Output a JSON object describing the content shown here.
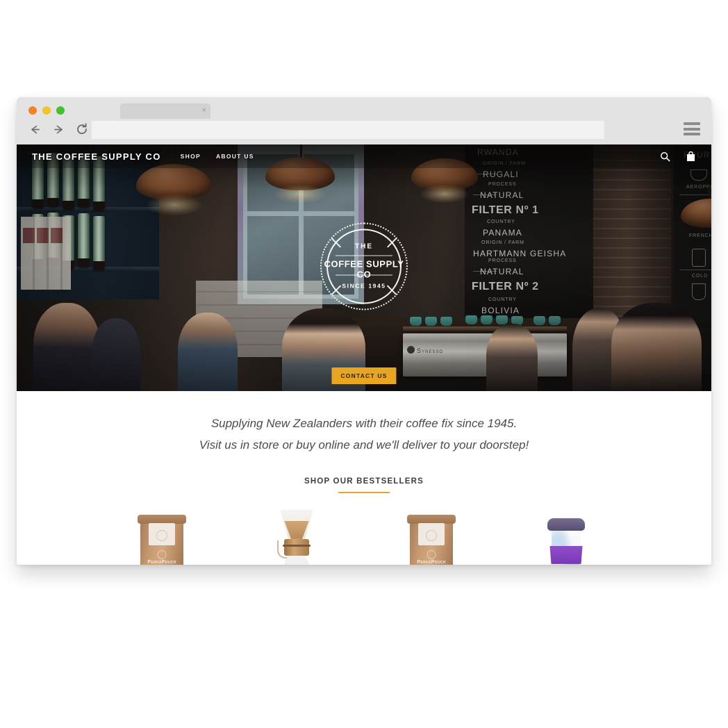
{
  "browser": {
    "tab_title": "",
    "tab_close_icon": "×",
    "address_value": "",
    "address_placeholder": "",
    "back_icon": "back-arrow-icon",
    "forward_icon": "forward-arrow-icon",
    "reload_icon": "reload-icon",
    "menu_icon": "hamburger-menu-icon",
    "traffic_lights": {
      "close": "#f7822a",
      "minimize": "#f2c42b",
      "maximize": "#44c032"
    }
  },
  "site": {
    "logo": "THE COFFEE SUPPLY CO",
    "nav": [
      {
        "label": "SHOP"
      },
      {
        "label": "ABOUT US"
      }
    ],
    "actions": [
      {
        "icon": "search-icon"
      },
      {
        "icon": "shopping-bag-icon"
      }
    ]
  },
  "hero": {
    "badge": {
      "the": "THE",
      "name": "COFFEE SUPPLY CO",
      "since": "SINCE 1945"
    },
    "cta_label": "CONTACT US",
    "cta_color": "#e8a520",
    "chalkboard_left": [
      {
        "text": "RWANDA",
        "class": "med"
      },
      {
        "text": "ORIGIN / FARM",
        "class": "small"
      },
      {
        "text": "RUGALI",
        "class": "med"
      },
      {
        "text": "PROCESS",
        "class": "small"
      },
      {
        "text": "NATURAL",
        "class": "med"
      },
      {
        "text": "FILTER No 1",
        "class": "big"
      },
      {
        "text": "COUNTRY",
        "class": "small"
      },
      {
        "text": "PANAMA",
        "class": "med"
      },
      {
        "text": "ORIGIN / FARM",
        "class": "small"
      },
      {
        "text": "HARTMANN GEISHA",
        "class": "med"
      },
      {
        "text": "PROCESS",
        "class": "small"
      },
      {
        "text": "NATURAL",
        "class": "med"
      },
      {
        "text": "FILTER No 2",
        "class": "big"
      },
      {
        "text": "COUNTRY",
        "class": "small"
      },
      {
        "text": "BOLIVIA",
        "class": "med"
      }
    ],
    "chalkboard_right": [
      {
        "text": "FOUR",
        "class": "med"
      },
      {
        "text": "AEROPRESS",
        "class": "small"
      },
      {
        "text": "FRENCH",
        "class": "small"
      },
      {
        "text": "COLD",
        "class": "small"
      }
    ],
    "espresso_machine_brand": "Synesso"
  },
  "content": {
    "tagline_line1": "Supplying New Zealanders with their coffee fix since 1945.",
    "tagline_line2": "Visit us in store or buy online and we'll deliver to your doorstep!",
    "bestsellers_heading": "SHOP OUR BESTSELLERS",
    "accent_color": "#e8a520",
    "products": [
      {
        "name": "coffee-pouch",
        "brand": "PerkaPouch"
      },
      {
        "name": "chemex-brewer",
        "brand": ""
      },
      {
        "name": "coffee-pouch",
        "brand": "PerkaPouch"
      },
      {
        "name": "reusable-keep-cup",
        "brand": ""
      }
    ]
  }
}
